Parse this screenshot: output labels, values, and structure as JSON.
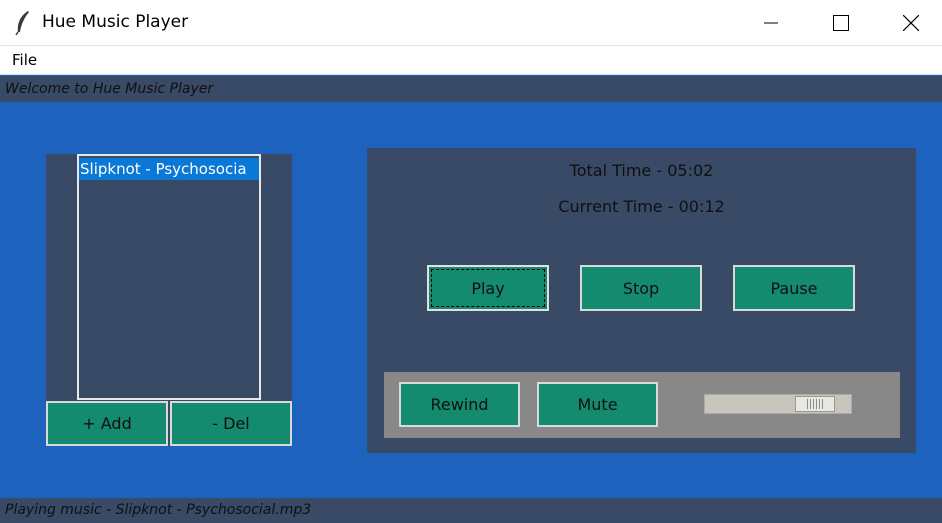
{
  "window": {
    "title": "Hue Music Player",
    "icons": {
      "app": "feather-icon",
      "minimize": "minimize-icon",
      "maximize": "maximize-icon",
      "close": "close-icon"
    }
  },
  "menu": {
    "file": "File"
  },
  "status": {
    "top": "Welcome to Hue Music Player",
    "bottom": "Playing music - Slipknot - Psychosocial.mp3"
  },
  "playlist": {
    "items": [
      "Slipknot - Psychosocia"
    ],
    "selected_index": 0
  },
  "playlist_buttons": {
    "add": "+ Add",
    "del": "- Del"
  },
  "player": {
    "total_time": "Total Time - 05:02",
    "current_time": "Current Time - 00:12",
    "play": "Play",
    "stop": "Stop",
    "pause": "Pause",
    "rewind": "Rewind",
    "mute": "Mute"
  },
  "volume": {
    "level": 0.85
  },
  "colors": {
    "background": "#1d62bd",
    "panel": "#384a66",
    "button": "#148a6e",
    "selection": "#0a78d7",
    "sub_panel": "#888888"
  }
}
